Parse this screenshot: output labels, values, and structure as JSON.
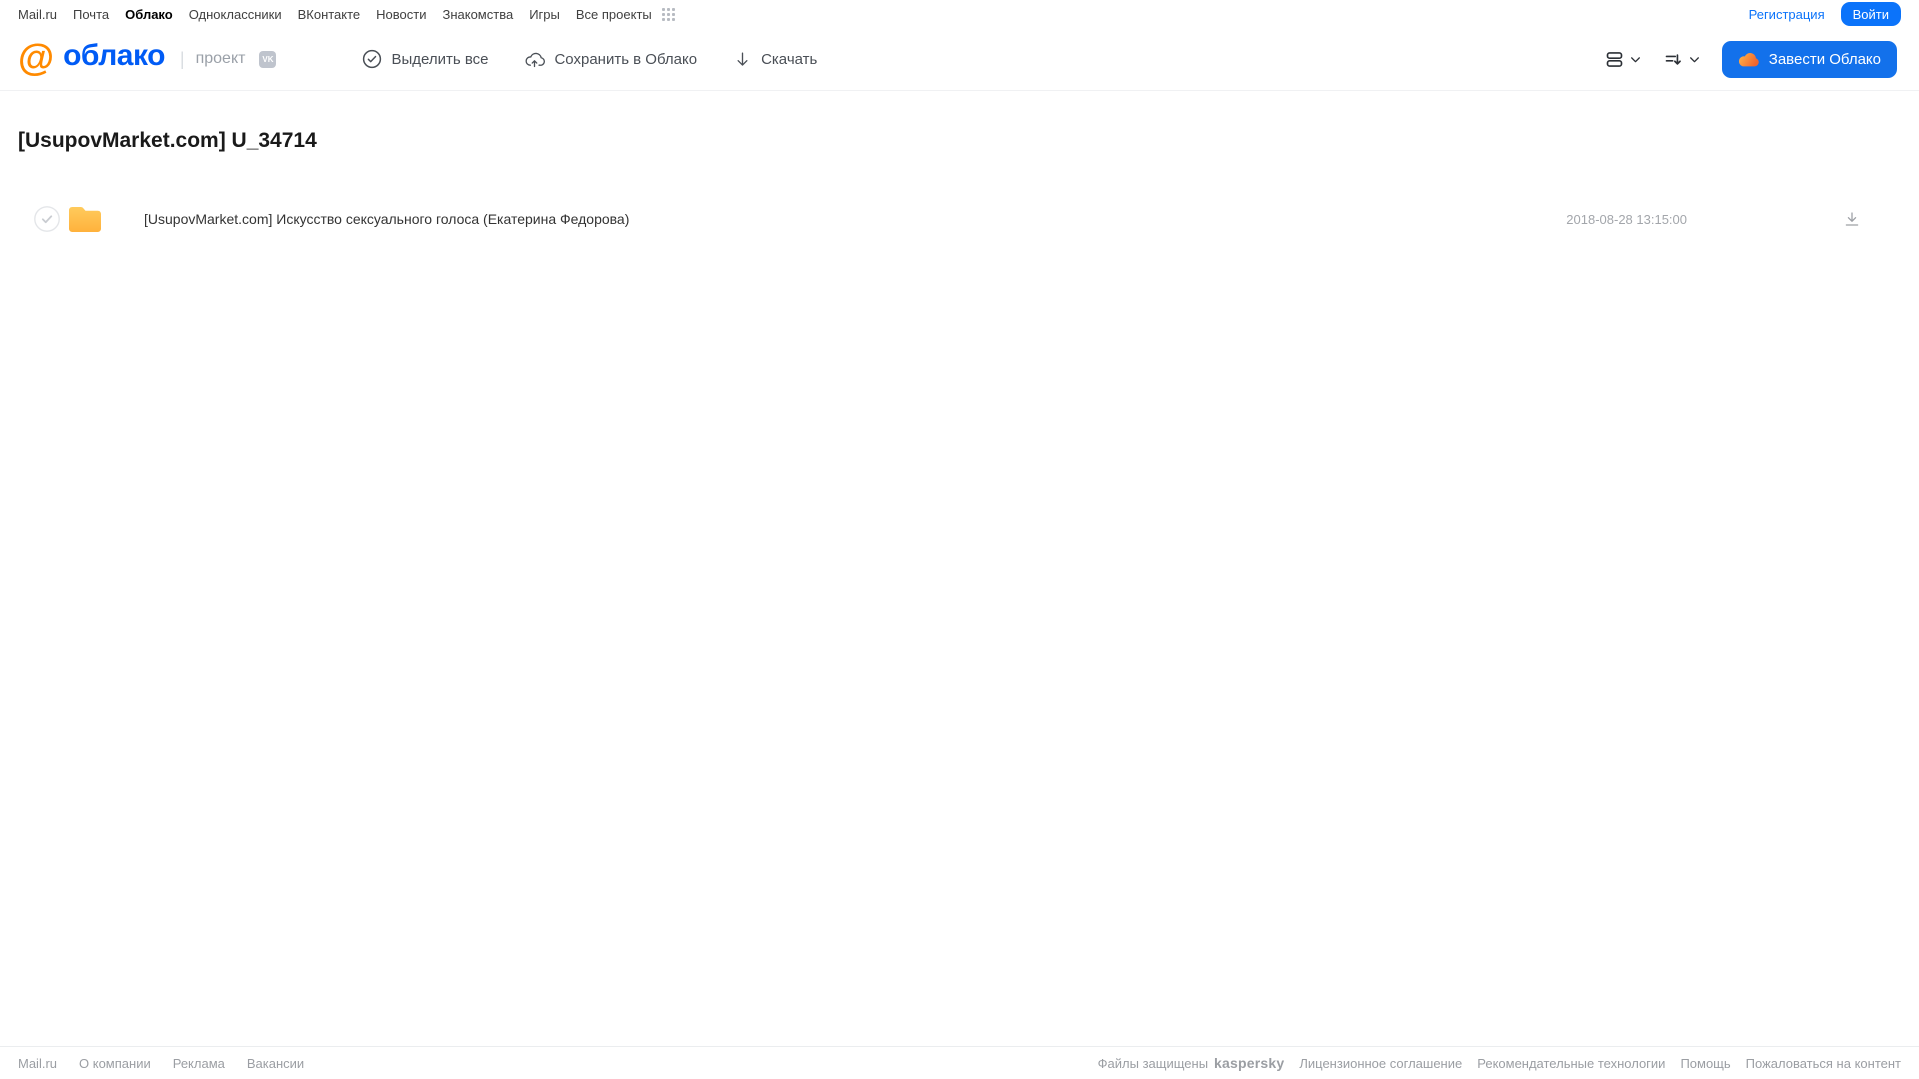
{
  "topnav": {
    "items": [
      "Mail.ru",
      "Почта",
      "Облако",
      "Одноклассники",
      "ВКонтакте",
      "Новости",
      "Знакомства",
      "Игры",
      "Все проекты"
    ],
    "active_item": "Облако",
    "registration_label": "Регистрация",
    "login_label": "Войти"
  },
  "header": {
    "logo_text": "облако",
    "logo_at": "@",
    "project_label": "проект",
    "vk_badge": "VK",
    "toolbar": {
      "select_all": "Выделить все",
      "save_to_cloud": "Сохранить в Облако",
      "download": "Скачать"
    },
    "create_cloud_label": "Завести Облако"
  },
  "main": {
    "title": "[UsupovMarket.com] U_34714",
    "files": [
      {
        "type": "folder",
        "name": "[UsupovMarket.com] Искусство сексуального голоса (Екатерина Федорова)",
        "date": "2018-08-28 13:15:00"
      }
    ]
  },
  "footer": {
    "left_links": [
      "Mail.ru",
      "О компании",
      "Реклама",
      "Вакансии"
    ],
    "protected_text": "Файлы защищены",
    "kaspersky_label": "kaspersky",
    "right_links": [
      "Лицензионное соглашение",
      "Рекомендательные технологии",
      "Помощь",
      "Пожаловаться на контент"
    ]
  },
  "icons": {
    "apps": "apps-grid-icon",
    "select_all": "check-circle-icon",
    "save_to_cloud": "cloud-upload-icon",
    "download": "download-arrow-icon",
    "view_mode": "list-view-icon",
    "sort": "sort-icon",
    "chevron": "chevron-down-icon",
    "create_cloud": "cloud-icon",
    "folder": "folder-icon",
    "checkbox": "check-icon",
    "vk": "vk-badge-icon",
    "logo": "at-icon"
  },
  "colors": {
    "brand_orange": "#ff8a00",
    "brand_blue": "#005bf5",
    "login_blue": "#0b73fa",
    "create_blue": "#1371eb",
    "folder_yellow_top": "#ffcb5c",
    "folder_yellow_bottom": "#ffb23c",
    "kaspersky_green": "#00a88e",
    "muted_gray": "#9b9ea3"
  }
}
